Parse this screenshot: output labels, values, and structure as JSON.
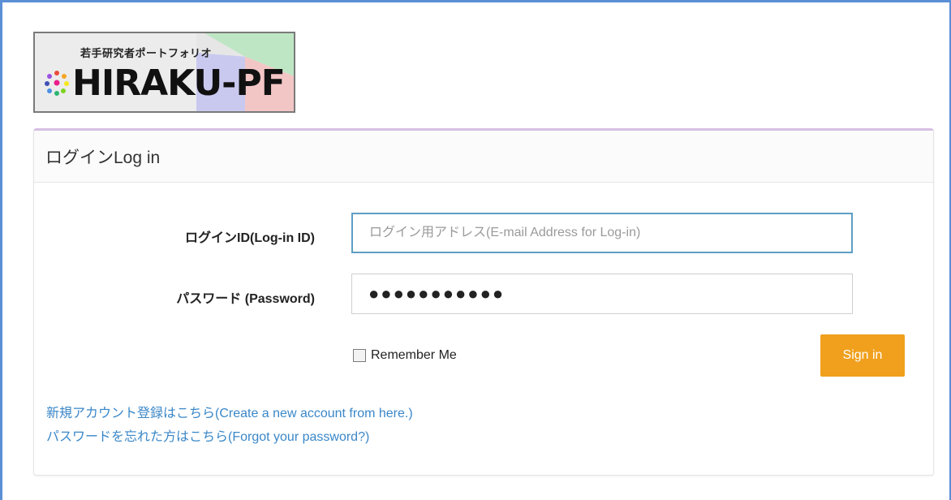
{
  "logo": {
    "tagline": "若手研究者ポートフォリオ",
    "wordmark": "HIRAKU-PF"
  },
  "panel": {
    "title": "ログインLog in"
  },
  "form": {
    "login_id_label": "ログインID(Log-in ID)",
    "login_id_placeholder": "ログイン用アドレス(E-mail Address for Log-in)",
    "login_id_value": "",
    "password_label": "パスワード (Password)",
    "password_value": "●●●●●●●●●●●",
    "remember_label": "Remember Me",
    "remember_checked": false,
    "signin_label": "Sign in"
  },
  "links": {
    "create_account": "新規アカウント登録はこちら(Create a new account from here.)",
    "forgot_password": "パスワードを忘れた方はこちら(Forgot your password?)"
  },
  "colors": {
    "accent": "#f0a01d",
    "link": "#3a87c8",
    "focus_border": "#5f9ec4",
    "panel_top": "#d6bfe4"
  }
}
